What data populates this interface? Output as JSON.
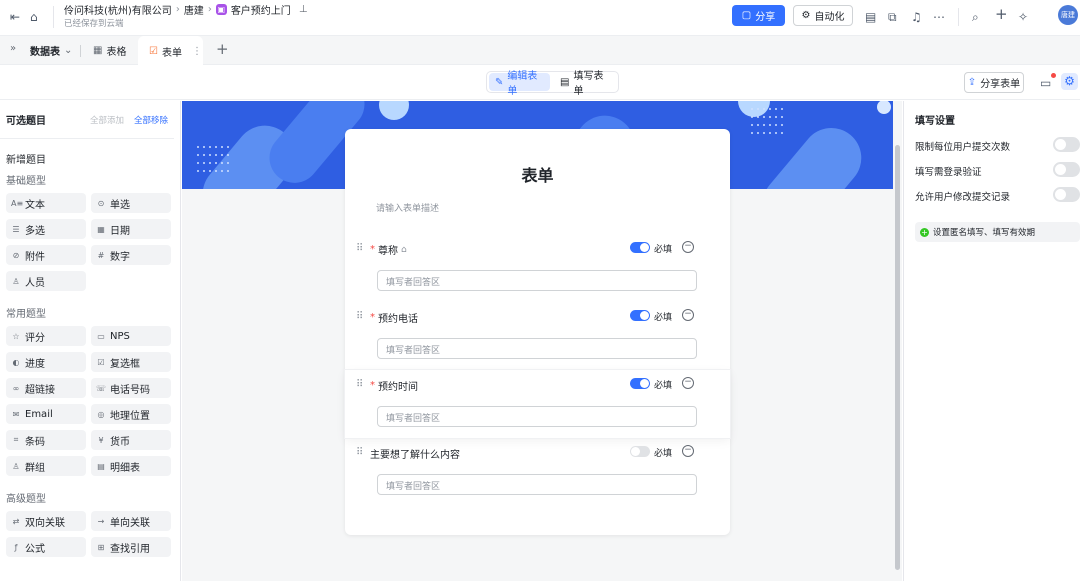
{
  "header": {
    "org": "伶问科技(杭州)有限公司",
    "user_crumb": "唐建",
    "app_name": "客户预约上门",
    "saved_status": "已经保存到云端",
    "share_label": "分享",
    "automation_label": "自动化",
    "avatar_text": "唐建"
  },
  "tabs": {
    "datasheet": "数据表",
    "table": "表格",
    "form": "表单"
  },
  "mode": {
    "edit_form": "编辑表单",
    "fill_form": "填写表单",
    "share_form": "分享表单"
  },
  "left_panel": {
    "title": "可选题目",
    "add_all": "全部添加",
    "remove_all": "全部移除",
    "new_section": "新增题目",
    "basic": {
      "title": "基础题型",
      "items": [
        {
          "icon": "A≡",
          "label": "文本"
        },
        {
          "icon": "⊙",
          "label": "单选"
        },
        {
          "icon": "☰",
          "label": "多选"
        },
        {
          "icon": "▦",
          "label": "日期"
        },
        {
          "icon": "⊘",
          "label": "附件"
        },
        {
          "icon": "#",
          "label": "数字"
        },
        {
          "icon": "♙",
          "label": "人员"
        }
      ]
    },
    "common": {
      "title": "常用题型",
      "items": [
        {
          "icon": "☆",
          "label": "评分"
        },
        {
          "icon": "▭",
          "label": "NPS"
        },
        {
          "icon": "◐",
          "label": "进度"
        },
        {
          "icon": "☑",
          "label": "复选框"
        },
        {
          "icon": "∞",
          "label": "超链接"
        },
        {
          "icon": "☏",
          "label": "电话号码"
        },
        {
          "icon": "✉",
          "label": "Email"
        },
        {
          "icon": "◎",
          "label": "地理位置"
        },
        {
          "icon": "⌗",
          "label": "条码"
        },
        {
          "icon": "¥",
          "label": "货币"
        },
        {
          "icon": "♙",
          "label": "群组"
        },
        {
          "icon": "▤",
          "label": "明细表"
        }
      ]
    },
    "advanced": {
      "title": "高级题型",
      "items": [
        {
          "icon": "⇄",
          "label": "双向关联"
        },
        {
          "icon": "→",
          "label": "单向关联"
        },
        {
          "icon": "ƒ",
          "label": "公式"
        },
        {
          "icon": "⊞",
          "label": "查找引用"
        }
      ]
    }
  },
  "form": {
    "title": "表单",
    "description_placeholder": "请输入表单描述",
    "required_label": "必填",
    "answer_placeholder": "填写者回答区",
    "questions": [
      {
        "label": "尊称",
        "required": true
      },
      {
        "label": "预约电话",
        "required": true
      },
      {
        "label": "预约时间",
        "required": true
      },
      {
        "label": "主要想了解什么内容",
        "required": false
      }
    ]
  },
  "settings": {
    "title": "填写设置",
    "items": [
      {
        "label": "限制每位用户提交次数",
        "enabled": false
      },
      {
        "label": "填写需登录验证",
        "enabled": false
      },
      {
        "label": "允许用户修改提交记录",
        "enabled": false
      }
    ],
    "anonymous_link": "设置匿名填写、填写有效期"
  },
  "colors": {
    "accent": "#3370ff",
    "banner": "#2f5ee2",
    "required_star": "#f54a45"
  }
}
